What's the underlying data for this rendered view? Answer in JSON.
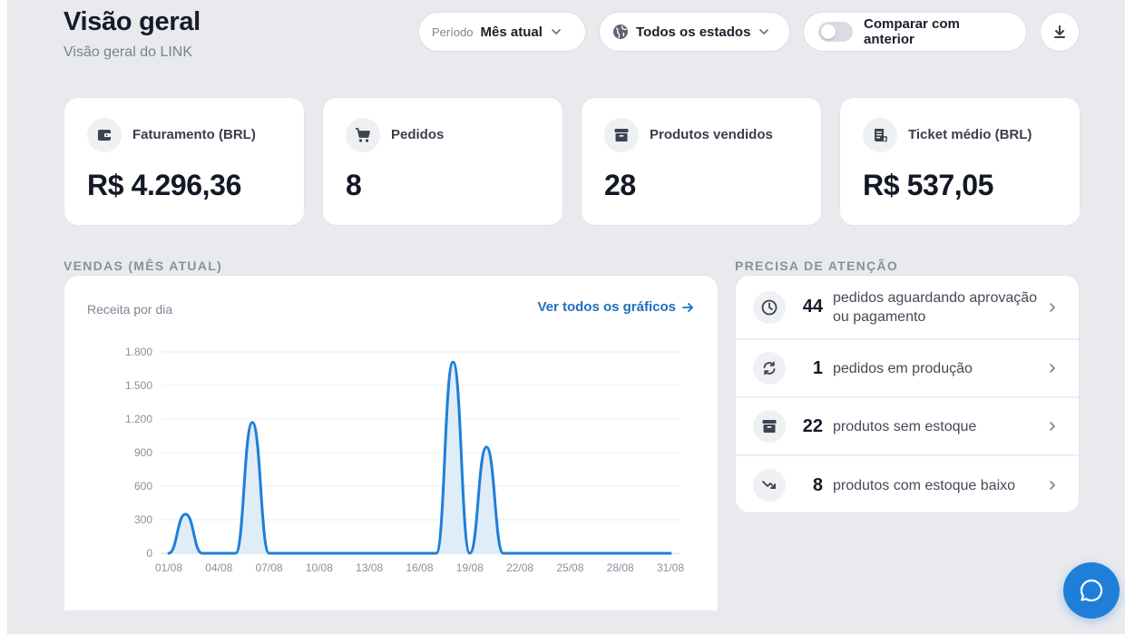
{
  "header": {
    "title": "Visão geral",
    "subtitle": "Visão geral do LINK"
  },
  "filters": {
    "period_label": "Período",
    "period_value": "Mês atual",
    "states_value": "Todos os estados",
    "compare_label": "Comparar com anterior",
    "compare_enabled": false
  },
  "kpis": [
    {
      "label": "Faturamento (BRL)",
      "value": "R$ 4.296,36",
      "icon": "wallet-icon"
    },
    {
      "label": "Pedidos",
      "value": "8",
      "icon": "cart-icon"
    },
    {
      "label": "Produtos vendidos",
      "value": "28",
      "icon": "archive-box-icon"
    },
    {
      "label": "Ticket médio (BRL)",
      "value": "R$ 537,05",
      "icon": "receipt-icon"
    }
  ],
  "sales": {
    "section_label": "VENDAS (MÊS ATUAL)",
    "subtitle": "Receita por dia",
    "link_label": "Ver todos os gráficos"
  },
  "attention": {
    "section_label": "PRECISA DE ATENÇÃO",
    "items": [
      {
        "count": "44",
        "text": "pedidos aguardando aprovação ou pagamento",
        "icon": "clock-icon"
      },
      {
        "count": "1",
        "text": "pedidos em produção",
        "icon": "refresh-icon"
      },
      {
        "count": "22",
        "text": "produtos sem estoque",
        "icon": "archive-box-icon"
      },
      {
        "count": "8",
        "text": "produtos com estoque baixo",
        "icon": "trending-down-icon"
      }
    ]
  },
  "colors": {
    "accent": "#1e70bd",
    "line": "#1f7fd8",
    "fill": "#dbeaf8",
    "fab": "#1f7fd8"
  },
  "chart_data": {
    "type": "area",
    "title": "",
    "subtitle": "Receita por dia",
    "xlabel": "",
    "ylabel": "",
    "x": [
      "01/08",
      "02/08",
      "03/08",
      "04/08",
      "05/08",
      "06/08",
      "07/08",
      "08/08",
      "09/08",
      "10/08",
      "11/08",
      "12/08",
      "13/08",
      "14/08",
      "15/08",
      "16/08",
      "17/08",
      "18/08",
      "19/08",
      "20/08",
      "21/08",
      "22/08",
      "23/08",
      "24/08",
      "25/08",
      "26/08",
      "27/08",
      "28/08",
      "29/08",
      "30/08",
      "31/08"
    ],
    "series": [
      {
        "values": [
          0,
          350,
          0,
          0,
          0,
          1170,
          0,
          0,
          0,
          0,
          0,
          0,
          0,
          0,
          0,
          0,
          0,
          1710,
          0,
          950,
          0,
          0,
          0,
          0,
          0,
          0,
          0,
          0,
          0,
          0,
          0
        ]
      }
    ],
    "x_tick_labels": [
      "01/08",
      "04/08",
      "07/08",
      "10/08",
      "13/08",
      "16/08",
      "19/08",
      "22/08",
      "25/08",
      "28/08",
      "31/08"
    ],
    "y_tick_labels": [
      "0",
      "300",
      "600",
      "900",
      "1.200",
      "1.500",
      "1.800"
    ],
    "y_ticks": [
      0,
      300,
      600,
      900,
      1200,
      1500,
      1800
    ],
    "ylim": [
      0,
      1800
    ],
    "grid": true,
    "legend": "none"
  }
}
